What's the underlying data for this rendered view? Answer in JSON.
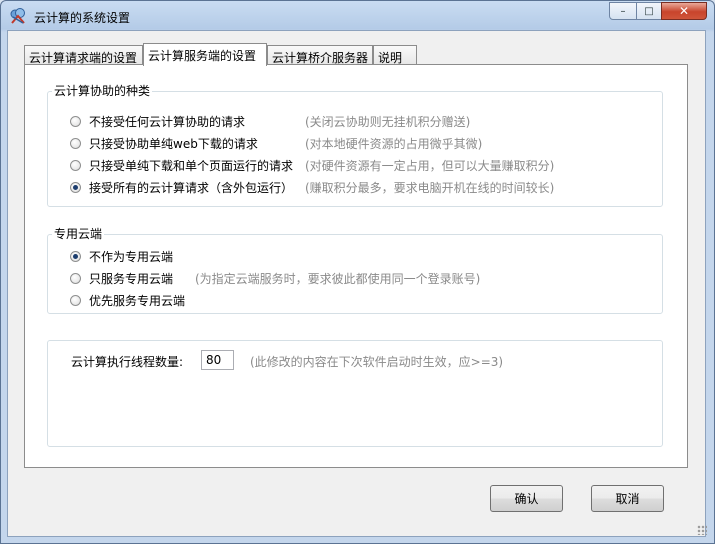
{
  "window": {
    "title": "云计算的系统设置",
    "minimize": "–",
    "maximize": "□",
    "close": "✕"
  },
  "tabs": [
    {
      "label": "云计算请求端的设置"
    },
    {
      "label": "云计算服务端的设置"
    },
    {
      "label": "云计算桥介服务器"
    },
    {
      "label": "说明"
    }
  ],
  "group1": {
    "title": "云计算协助的种类",
    "options": [
      {
        "label": "不接受任何云计算协助的请求",
        "hint": "(关闭云协助则无挂机积分赠送)",
        "checked": false
      },
      {
        "label": "只接受协助单纯web下载的请求",
        "hint": "(对本地硬件资源的占用微乎其微)",
        "checked": false
      },
      {
        "label": "只接受单纯下载和单个页面运行的请求",
        "hint": "(对硬件资源有一定占用，但可以大量赚取积分)",
        "checked": false
      },
      {
        "label": "接受所有的云计算请求（含外包运行）",
        "hint": "(赚取积分最多，要求电脑开机在线的时间较长)",
        "checked": true
      }
    ]
  },
  "group2": {
    "title": "专用云端",
    "options": [
      {
        "label": "不作为专用云端",
        "hint": "",
        "checked": true
      },
      {
        "label": "只服务专用云端",
        "hint": "(为指定云端服务时，要求彼此都使用同一个登录账号)",
        "checked": false
      },
      {
        "label": "优先服务专用云端",
        "hint": "",
        "checked": false
      }
    ]
  },
  "threads": {
    "label": "云计算执行线程数量:",
    "value": "80",
    "hint": "(此修改的内容在下次软件启动时生效，应>=3)"
  },
  "buttons": {
    "ok": "确认",
    "cancel": "取消"
  }
}
